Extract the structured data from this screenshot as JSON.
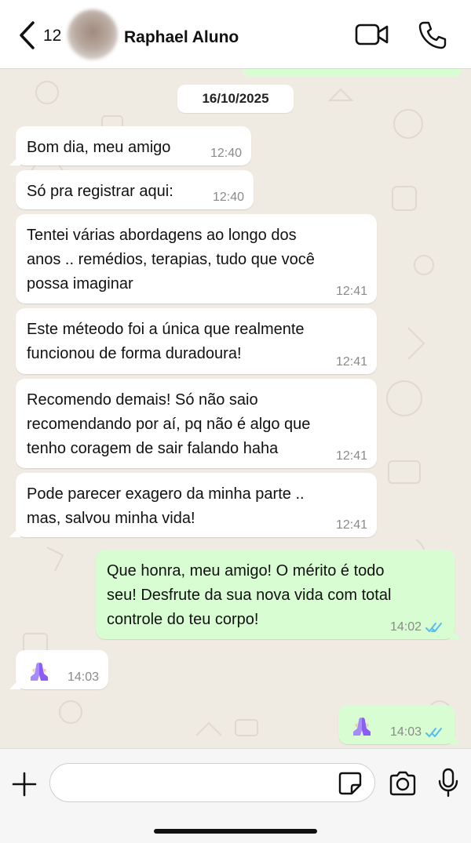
{
  "header": {
    "unread_count": "12",
    "contact_name": "Raphael Aluno",
    "icons": [
      "chevron-left-icon",
      "video-camera-icon",
      "phone-icon"
    ]
  },
  "chat": {
    "date_chip": "16/10/2025",
    "messages": [
      {
        "direction": "in",
        "lines": [
          "Bom dia, meu amigo"
        ],
        "time": "12:40"
      },
      {
        "direction": "in",
        "lines": [
          "Só pra registrar aqui:"
        ],
        "time": "12:40"
      },
      {
        "direction": "in",
        "lines": [
          "Tentei várias abordagens ao longo dos",
          "anos .. remédios, terapias, tudo que você",
          "possa imaginar"
        ],
        "time": "12:41"
      },
      {
        "direction": "in",
        "lines": [
          "Este méteodo foi a única que realmente",
          "funcionou de forma duradoura!"
        ],
        "time": "12:41"
      },
      {
        "direction": "in",
        "lines": [
          "Recomendo demais! Só não saio",
          "recomendando por aí, pq não é algo que",
          "tenho coragem de sair falando haha"
        ],
        "time": "12:41"
      },
      {
        "direction": "in",
        "lines": [
          "Pode parecer exagero da minha parte ..",
          "mas, salvou minha vida!"
        ],
        "time": "12:41"
      },
      {
        "direction": "out",
        "lines": [
          "Que honra, meu amigo! O mérito é todo",
          "seu! Desfrute da sua nova vida com total",
          "controle do teu corpo!"
        ],
        "time": "14:02",
        "status": "read"
      },
      {
        "direction": "in",
        "emoji": "praying-hands-icon",
        "time": "14:03"
      },
      {
        "direction": "out",
        "emoji": "praying-hands-icon",
        "time": "14:03",
        "status": "read"
      }
    ]
  },
  "composer": {
    "input_value": "",
    "icons": [
      "plus-icon",
      "sticker-icon",
      "camera-icon",
      "microphone-icon"
    ]
  },
  "colors": {
    "incoming_bubble": "#ffffff",
    "outgoing_bubble": "#d9fdd3",
    "wallpaper": "#efeae2",
    "read_ticks": "#53bdeb",
    "emoji_accent": "#a78bfa"
  }
}
